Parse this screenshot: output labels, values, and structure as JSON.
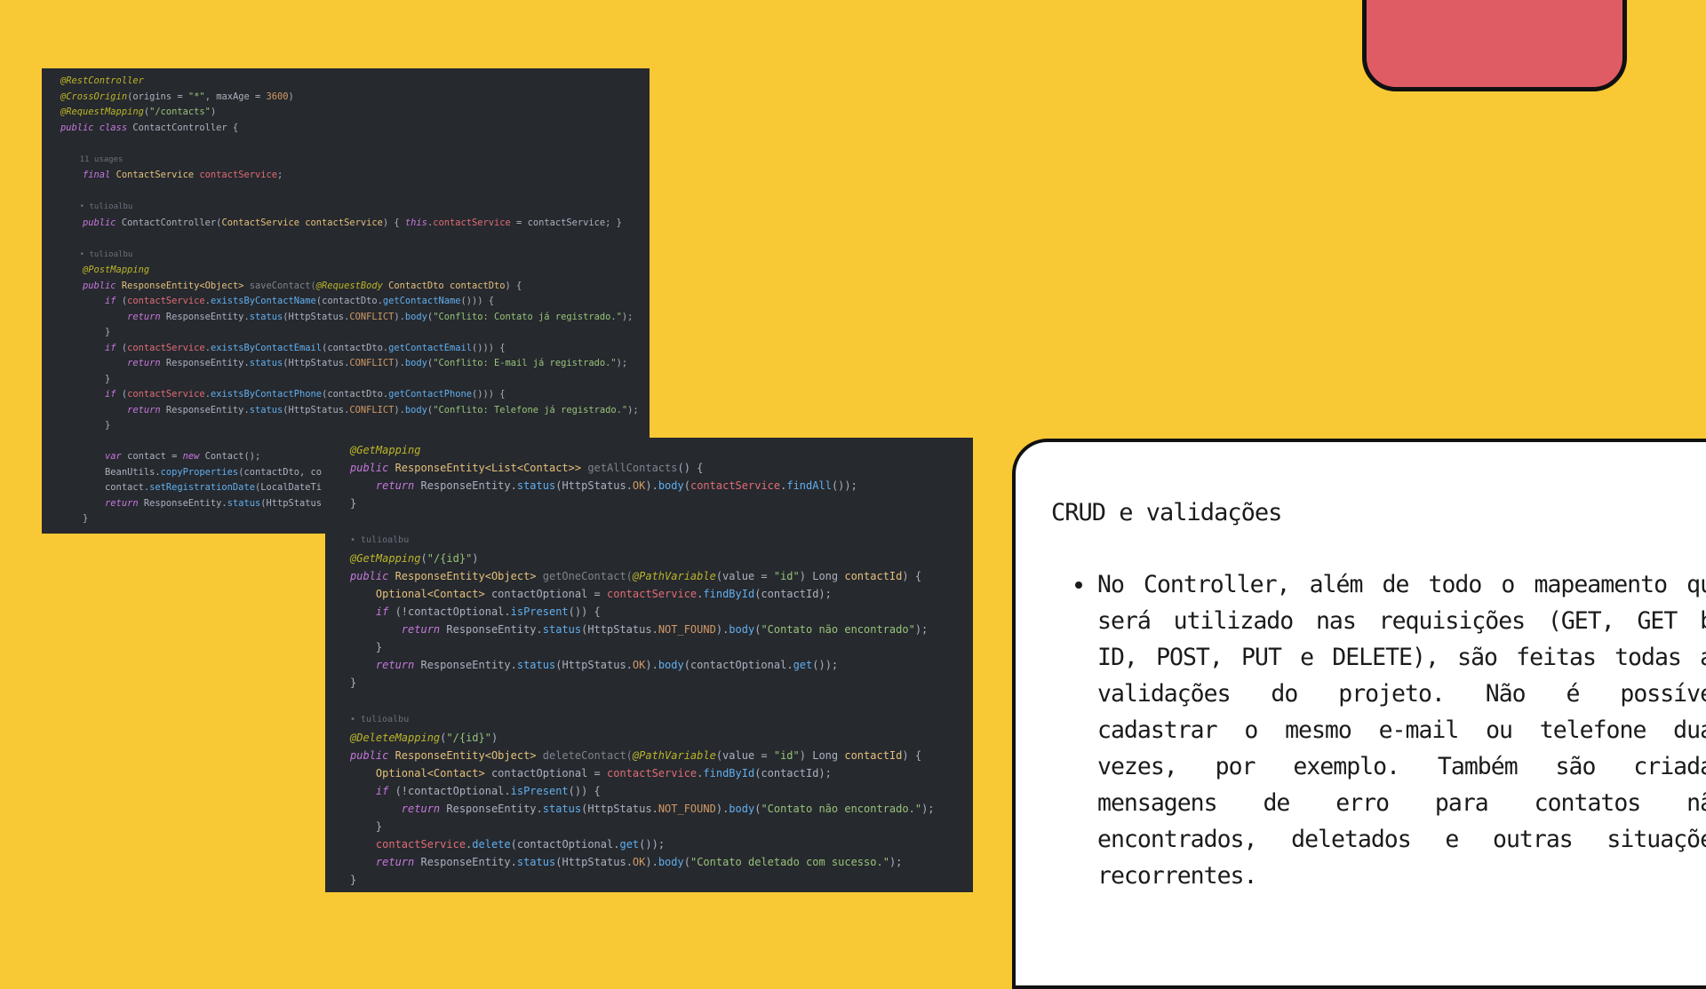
{
  "decorations": {
    "red_card_color": "#E05C65",
    "background": "#F8C935"
  },
  "code_panel_1": {
    "lines": [
      [
        {
          "t": "@RestController",
          "c": "ann"
        }
      ],
      [
        {
          "t": "@CrossOrigin",
          "c": "ann"
        },
        {
          "t": "(origins = ",
          "c": "txt"
        },
        {
          "t": "\"*\"",
          "c": "str"
        },
        {
          "t": ", maxAge = ",
          "c": "txt"
        },
        {
          "t": "3600",
          "c": "num"
        },
        {
          "t": ")",
          "c": "txt"
        }
      ],
      [
        {
          "t": "@RequestMapping",
          "c": "ann"
        },
        {
          "t": "(",
          "c": "txt"
        },
        {
          "t": "\"/contacts\"",
          "c": "str"
        },
        {
          "t": ")",
          "c": "txt"
        }
      ],
      [
        {
          "t": "public class ",
          "c": "kw"
        },
        {
          "t": "ContactController {",
          "c": "txt"
        }
      ],
      [],
      [
        {
          "t": "    11 usages",
          "c": "meta"
        }
      ],
      [
        {
          "t": "    final ",
          "c": "kw"
        },
        {
          "t": "ContactService ",
          "c": "cls"
        },
        {
          "t": "contactService",
          "c": "fld"
        },
        {
          "t": ";",
          "c": "txt"
        }
      ],
      [],
      [
        {
          "t": "    • tulioalbu",
          "c": "meta"
        }
      ],
      [
        {
          "t": "    public ",
          "c": "kw"
        },
        {
          "t": "ContactController(",
          "c": "txt"
        },
        {
          "t": "ContactService ",
          "c": "cls"
        },
        {
          "t": "contactService",
          "c": "par"
        },
        {
          "t": ") { ",
          "c": "txt"
        },
        {
          "t": "this",
          "c": "kw"
        },
        {
          "t": ".",
          "c": "txt"
        },
        {
          "t": "contactService",
          "c": "fld"
        },
        {
          "t": " = contactService; }",
          "c": "txt"
        }
      ],
      [],
      [
        {
          "t": "    • tulioalbu",
          "c": "meta"
        }
      ],
      [
        {
          "t": "    @PostMapping",
          "c": "ann"
        }
      ],
      [
        {
          "t": "    public ",
          "c": "kw"
        },
        {
          "t": "ResponseEntity<Object> ",
          "c": "cls"
        },
        {
          "t": "saveContact(",
          "c": "grey"
        },
        {
          "t": "@RequestBody ",
          "c": "ann"
        },
        {
          "t": "ContactDto ",
          "c": "cls"
        },
        {
          "t": "contactDto",
          "c": "par"
        },
        {
          "t": ") {",
          "c": "txt"
        }
      ],
      [
        {
          "t": "        if ",
          "c": "kw"
        },
        {
          "t": "(",
          "c": "txt"
        },
        {
          "t": "contactService",
          "c": "fld"
        },
        {
          "t": ".",
          "c": "txt"
        },
        {
          "t": "existsByContactName",
          "c": "mth"
        },
        {
          "t": "(contactDto.",
          "c": "txt"
        },
        {
          "t": "getContactName",
          "c": "mth"
        },
        {
          "t": "())) {",
          "c": "txt"
        }
      ],
      [
        {
          "t": "            return ",
          "c": "kw"
        },
        {
          "t": "ResponseEntity.",
          "c": "txt"
        },
        {
          "t": "status",
          "c": "mth"
        },
        {
          "t": "(HttpStatus.",
          "c": "txt"
        },
        {
          "t": "CONFLICT",
          "c": "const"
        },
        {
          "t": ").",
          "c": "txt"
        },
        {
          "t": "body",
          "c": "mth"
        },
        {
          "t": "(",
          "c": "txt"
        },
        {
          "t": "\"Conflito: Contato já registrado.\"",
          "c": "str"
        },
        {
          "t": ");",
          "c": "txt"
        }
      ],
      [
        {
          "t": "        }",
          "c": "txt"
        }
      ],
      [
        {
          "t": "        if ",
          "c": "kw"
        },
        {
          "t": "(",
          "c": "txt"
        },
        {
          "t": "contactService",
          "c": "fld"
        },
        {
          "t": ".",
          "c": "txt"
        },
        {
          "t": "existsByContactEmail",
          "c": "mth"
        },
        {
          "t": "(contactDto.",
          "c": "txt"
        },
        {
          "t": "getContactEmail",
          "c": "mth"
        },
        {
          "t": "())) {",
          "c": "txt"
        }
      ],
      [
        {
          "t": "            return ",
          "c": "kw"
        },
        {
          "t": "ResponseEntity.",
          "c": "txt"
        },
        {
          "t": "status",
          "c": "mth"
        },
        {
          "t": "(HttpStatus.",
          "c": "txt"
        },
        {
          "t": "CONFLICT",
          "c": "const"
        },
        {
          "t": ").",
          "c": "txt"
        },
        {
          "t": "body",
          "c": "mth"
        },
        {
          "t": "(",
          "c": "txt"
        },
        {
          "t": "\"Conflito: E-mail já registrado.\"",
          "c": "str"
        },
        {
          "t": ");",
          "c": "txt"
        }
      ],
      [
        {
          "t": "        }",
          "c": "txt"
        }
      ],
      [
        {
          "t": "        if ",
          "c": "kw"
        },
        {
          "t": "(",
          "c": "txt"
        },
        {
          "t": "contactService",
          "c": "fld"
        },
        {
          "t": ".",
          "c": "txt"
        },
        {
          "t": "existsByContactPhone",
          "c": "mth"
        },
        {
          "t": "(contactDto.",
          "c": "txt"
        },
        {
          "t": "getContactPhone",
          "c": "mth"
        },
        {
          "t": "())) {",
          "c": "txt"
        }
      ],
      [
        {
          "t": "            return ",
          "c": "kw"
        },
        {
          "t": "ResponseEntity.",
          "c": "txt"
        },
        {
          "t": "status",
          "c": "mth"
        },
        {
          "t": "(HttpStatus.",
          "c": "txt"
        },
        {
          "t": "CONFLICT",
          "c": "const"
        },
        {
          "t": ").",
          "c": "txt"
        },
        {
          "t": "body",
          "c": "mth"
        },
        {
          "t": "(",
          "c": "txt"
        },
        {
          "t": "\"Conflito: Telefone já registrado.\"",
          "c": "str"
        },
        {
          "t": ");",
          "c": "txt"
        }
      ],
      [
        {
          "t": "        }",
          "c": "txt"
        }
      ],
      [],
      [
        {
          "t": "        var ",
          "c": "kw"
        },
        {
          "t": "contact = ",
          "c": "txt"
        },
        {
          "t": "new ",
          "c": "kw"
        },
        {
          "t": "Contact();",
          "c": "txt"
        }
      ],
      [
        {
          "t": "        BeanUtils.",
          "c": "txt"
        },
        {
          "t": "copyProperties",
          "c": "mth"
        },
        {
          "t": "(contactDto, co",
          "c": "txt"
        }
      ],
      [
        {
          "t": "        contact.",
          "c": "txt"
        },
        {
          "t": "setRegistrationDate",
          "c": "mth"
        },
        {
          "t": "(LocalDateTi",
          "c": "txt"
        }
      ],
      [
        {
          "t": "        return ",
          "c": "kw"
        },
        {
          "t": "ResponseEntity.",
          "c": "txt"
        },
        {
          "t": "status",
          "c": "mth"
        },
        {
          "t": "(HttpStatus",
          "c": "txt"
        }
      ],
      [
        {
          "t": "    }",
          "c": "txt"
        }
      ]
    ]
  },
  "code_panel_2": {
    "lines": [
      [
        {
          "t": "@GetMapping",
          "c": "ann"
        }
      ],
      [
        {
          "t": "public ",
          "c": "kw"
        },
        {
          "t": "ResponseEntity<List<Contact>> ",
          "c": "cls"
        },
        {
          "t": "getAllContacts",
          "c": "grey"
        },
        {
          "t": "() {",
          "c": "txt"
        }
      ],
      [
        {
          "t": "    return ",
          "c": "kw"
        },
        {
          "t": "ResponseEntity.",
          "c": "txt"
        },
        {
          "t": "status",
          "c": "mth"
        },
        {
          "t": "(HttpStatus.",
          "c": "txt"
        },
        {
          "t": "OK",
          "c": "const"
        },
        {
          "t": ").",
          "c": "txt"
        },
        {
          "t": "body",
          "c": "mth"
        },
        {
          "t": "(",
          "c": "txt"
        },
        {
          "t": "contactService",
          "c": "fld"
        },
        {
          "t": ".",
          "c": "txt"
        },
        {
          "t": "findAll",
          "c": "mth"
        },
        {
          "t": "());",
          "c": "txt"
        }
      ],
      [
        {
          "t": "}",
          "c": "txt"
        }
      ],
      [],
      [
        {
          "t": "• tulioalbu",
          "c": "meta"
        }
      ],
      [
        {
          "t": "@GetMapping",
          "c": "ann"
        },
        {
          "t": "(",
          "c": "txt"
        },
        {
          "t": "\"/{id}\"",
          "c": "str"
        },
        {
          "t": ")",
          "c": "txt"
        }
      ],
      [
        {
          "t": "public ",
          "c": "kw"
        },
        {
          "t": "ResponseEntity<Object> ",
          "c": "cls"
        },
        {
          "t": "getOneContact(",
          "c": "grey"
        },
        {
          "t": "@PathVariable",
          "c": "ann"
        },
        {
          "t": "(value = ",
          "c": "txt"
        },
        {
          "t": "\"id\"",
          "c": "str"
        },
        {
          "t": ") Long ",
          "c": "txt"
        },
        {
          "t": "contactId",
          "c": "par"
        },
        {
          "t": ") {",
          "c": "txt"
        }
      ],
      [
        {
          "t": "    Optional<Contact> ",
          "c": "cls"
        },
        {
          "t": "contactOptional = ",
          "c": "txt"
        },
        {
          "t": "contactService",
          "c": "fld"
        },
        {
          "t": ".",
          "c": "txt"
        },
        {
          "t": "findById",
          "c": "mth"
        },
        {
          "t": "(contactId);",
          "c": "txt"
        }
      ],
      [
        {
          "t": "    if ",
          "c": "kw"
        },
        {
          "t": "(!contactOptional.",
          "c": "txt"
        },
        {
          "t": "isPresent",
          "c": "mth"
        },
        {
          "t": "()) {",
          "c": "txt"
        }
      ],
      [
        {
          "t": "        return ",
          "c": "kw"
        },
        {
          "t": "ResponseEntity.",
          "c": "txt"
        },
        {
          "t": "status",
          "c": "mth"
        },
        {
          "t": "(HttpStatus.",
          "c": "txt"
        },
        {
          "t": "NOT_FOUND",
          "c": "const"
        },
        {
          "t": ").",
          "c": "txt"
        },
        {
          "t": "body",
          "c": "mth"
        },
        {
          "t": "(",
          "c": "txt"
        },
        {
          "t": "\"Contato não encontrado\"",
          "c": "str"
        },
        {
          "t": ");",
          "c": "txt"
        }
      ],
      [
        {
          "t": "    }",
          "c": "txt"
        }
      ],
      [
        {
          "t": "    return ",
          "c": "kw"
        },
        {
          "t": "ResponseEntity.",
          "c": "txt"
        },
        {
          "t": "status",
          "c": "mth"
        },
        {
          "t": "(HttpStatus.",
          "c": "txt"
        },
        {
          "t": "OK",
          "c": "const"
        },
        {
          "t": ").",
          "c": "txt"
        },
        {
          "t": "body",
          "c": "mth"
        },
        {
          "t": "(contactOptional.",
          "c": "txt"
        },
        {
          "t": "get",
          "c": "mth"
        },
        {
          "t": "());",
          "c": "txt"
        }
      ],
      [
        {
          "t": "}",
          "c": "txt"
        }
      ],
      [],
      [
        {
          "t": "• tulioalbu",
          "c": "meta"
        }
      ],
      [
        {
          "t": "@DeleteMapping",
          "c": "ann"
        },
        {
          "t": "(",
          "c": "txt"
        },
        {
          "t": "\"/{id}\"",
          "c": "str"
        },
        {
          "t": ")",
          "c": "txt"
        }
      ],
      [
        {
          "t": "public ",
          "c": "kw"
        },
        {
          "t": "ResponseEntity<Object> ",
          "c": "cls"
        },
        {
          "t": "deleteContact(",
          "c": "grey"
        },
        {
          "t": "@PathVariable",
          "c": "ann"
        },
        {
          "t": "(value = ",
          "c": "txt"
        },
        {
          "t": "\"id\"",
          "c": "str"
        },
        {
          "t": ") Long ",
          "c": "txt"
        },
        {
          "t": "contactId",
          "c": "par"
        },
        {
          "t": ") {",
          "c": "txt"
        }
      ],
      [
        {
          "t": "    Optional<Contact> ",
          "c": "cls"
        },
        {
          "t": "contactOptional = ",
          "c": "txt"
        },
        {
          "t": "contactService",
          "c": "fld"
        },
        {
          "t": ".",
          "c": "txt"
        },
        {
          "t": "findById",
          "c": "mth"
        },
        {
          "t": "(contactId);",
          "c": "txt"
        }
      ],
      [
        {
          "t": "    if ",
          "c": "kw"
        },
        {
          "t": "(!contactOptional.",
          "c": "txt"
        },
        {
          "t": "isPresent",
          "c": "mth"
        },
        {
          "t": "()) {",
          "c": "txt"
        }
      ],
      [
        {
          "t": "        return ",
          "c": "kw"
        },
        {
          "t": "ResponseEntity.",
          "c": "txt"
        },
        {
          "t": "status",
          "c": "mth"
        },
        {
          "t": "(HttpStatus.",
          "c": "txt"
        },
        {
          "t": "NOT_FOUND",
          "c": "const"
        },
        {
          "t": ").",
          "c": "txt"
        },
        {
          "t": "body",
          "c": "mth"
        },
        {
          "t": "(",
          "c": "txt"
        },
        {
          "t": "\"Contato não encontrado.\"",
          "c": "str"
        },
        {
          "t": ");",
          "c": "txt"
        }
      ],
      [
        {
          "t": "    }",
          "c": "txt"
        }
      ],
      [
        {
          "t": "    contactService",
          "c": "fld"
        },
        {
          "t": ".",
          "c": "txt"
        },
        {
          "t": "delete",
          "c": "mth"
        },
        {
          "t": "(contactOptional.",
          "c": "txt"
        },
        {
          "t": "get",
          "c": "mth"
        },
        {
          "t": "());",
          "c": "txt"
        }
      ],
      [
        {
          "t": "    return ",
          "c": "kw"
        },
        {
          "t": "ResponseEntity.",
          "c": "txt"
        },
        {
          "t": "status",
          "c": "mth"
        },
        {
          "t": "(HttpStatus.",
          "c": "txt"
        },
        {
          "t": "OK",
          "c": "const"
        },
        {
          "t": ").",
          "c": "txt"
        },
        {
          "t": "body",
          "c": "mth"
        },
        {
          "t": "(",
          "c": "txt"
        },
        {
          "t": "\"Contato deletado com sucesso.\"",
          "c": "str"
        },
        {
          "t": ");",
          "c": "txt"
        }
      ],
      [
        {
          "t": "}",
          "c": "txt"
        }
      ]
    ]
  },
  "card": {
    "title": "CRUD e validações",
    "bullets": [
      "No Controller, além de todo o mapeamento que será utilizado nas requisições (GET, GET by ID, POST, PUT e DELETE), são feitas todas as validações do projeto. Não é possível cadastrar o mesmo e-mail ou telefone duas vezes, por exemplo. Também são criadas mensagens de erro para contatos não encontrados, deletados e outras situações recorrentes."
    ]
  }
}
